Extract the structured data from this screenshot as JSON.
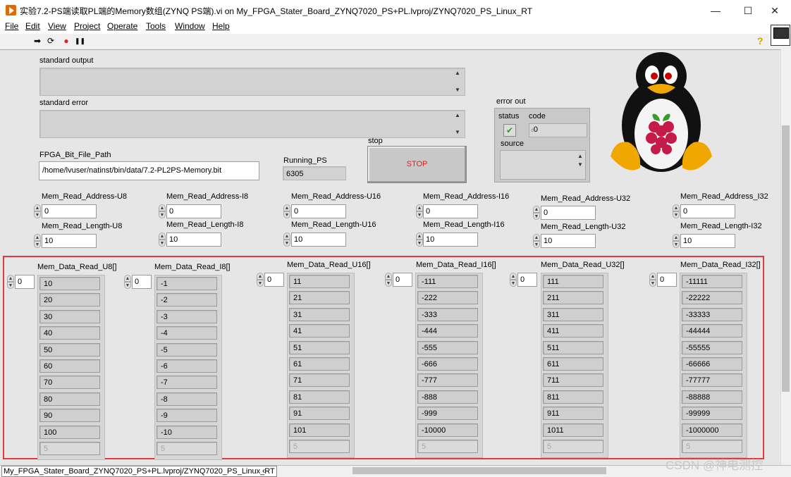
{
  "window": {
    "title": "实验7.2-PS端读取PL端的Memory数组(ZYNQ PS端).vi on My_FPGA_Stater_Board_ZYNQ7020_PS+PL.lvproj/ZYNQ7020_PS_Linux_RT",
    "minimize": "—",
    "maximize": "☐",
    "close": "✕"
  },
  "menu": [
    "File",
    "Edit",
    "View",
    "Project",
    "Operate",
    "Tools",
    "Window",
    "Help"
  ],
  "toolbar": {
    "run": "➡",
    "run_continuously": "⟳",
    "abort": "●",
    "pause": "❚❚",
    "help": "?"
  },
  "panel": {
    "standard_output": {
      "label": "standard output",
      "value": ""
    },
    "standard_error": {
      "label": "standard error",
      "value": ""
    },
    "fpga_bit_file_path": {
      "label": "FPGA_Bit_File_Path",
      "value": "/home/lvuser/natinst/bin/data/7.2-PL2PS-Memory.bit"
    },
    "running_ps": {
      "label": "Running_PS",
      "value": "6305"
    },
    "stop": {
      "label": "stop",
      "button_text": "STOP"
    },
    "error_out": {
      "label": "error out",
      "status_label": "status",
      "status_glyph": "✔",
      "code_label": "code",
      "code_prefix": "d",
      "code_value": "0",
      "source_label": "source",
      "source_value": ""
    }
  },
  "controls": [
    {
      "addr_label": "Mem_Read_Address-U8",
      "addr_value": "0",
      "len_label": "Mem_Read_Length-U8",
      "len_value": "10"
    },
    {
      "addr_label": "Mem_Read_Address-I8",
      "addr_value": "0",
      "len_label": "Mem_Read_Length-I8",
      "len_value": "10"
    },
    {
      "addr_label": "Mem_Read_Address-U16",
      "addr_value": "0",
      "len_label": "Mem_Read_Length-U16",
      "len_value": "10"
    },
    {
      "addr_label": "Mem_Read_Address-I16",
      "addr_value": "0",
      "len_label": "Mem_Read_Length-I16",
      "len_value": "10"
    },
    {
      "addr_label": "Mem_Read_Address-U32",
      "addr_value": "0",
      "len_label": "Mem_Read_Length-U32",
      "len_value": "10"
    },
    {
      "addr_label": "Mem_Read_Address_I32",
      "addr_value": "0",
      "len_label": "Mem_Read_Length-I32",
      "len_value": "10"
    }
  ],
  "arrays": [
    {
      "label": "Mem_Data_Read_U8[]",
      "index": "0",
      "values": [
        "10",
        "20",
        "30",
        "40",
        "50",
        "60",
        "70",
        "80",
        "90",
        "100"
      ],
      "placeholder": "5"
    },
    {
      "label": "Mem_Data_Read_I8[]",
      "index": "0",
      "values": [
        "-1",
        "-2",
        "-3",
        "-4",
        "-5",
        "-6",
        "-7",
        "-8",
        "-9",
        "-10"
      ],
      "placeholder": "5"
    },
    {
      "label": "Mem_Data_Read_U16[]",
      "index": "0",
      "values": [
        "11",
        "21",
        "31",
        "41",
        "51",
        "61",
        "71",
        "81",
        "91",
        "101"
      ],
      "placeholder": "5"
    },
    {
      "label": "Mem_Data_Read_I16[]",
      "index": "0",
      "values": [
        "-111",
        "-222",
        "-333",
        "-444",
        "-555",
        "-666",
        "-777",
        "-888",
        "-999",
        "-10000"
      ],
      "placeholder": "5"
    },
    {
      "label": "Mem_Data_Read_U32[]",
      "index": "0",
      "values": [
        "111",
        "211",
        "311",
        "411",
        "511",
        "611",
        "711",
        "811",
        "911",
        "1011"
      ],
      "placeholder": "5"
    },
    {
      "label": "Mem_Data_Read_I32[]",
      "index": "0",
      "values": [
        "-11111",
        "-22222",
        "-33333",
        "-44444",
        "-55555",
        "-66666",
        "-77777",
        "-88888",
        "-99999",
        "-1000000"
      ],
      "placeholder": "5"
    }
  ],
  "statusbar": {
    "path": "My_FPGA_Stater_Board_ZYNQ7020_PS+PL.lvproj/ZYNQ7020_PS_Linux_RT",
    "scroll_left": "‹"
  },
  "watermark": "CSDN @神电测控",
  "colors": {
    "highlight_frame": "#e23a3a",
    "stop_text": "#e41c1c",
    "status_ok": "#2a9a2a"
  }
}
